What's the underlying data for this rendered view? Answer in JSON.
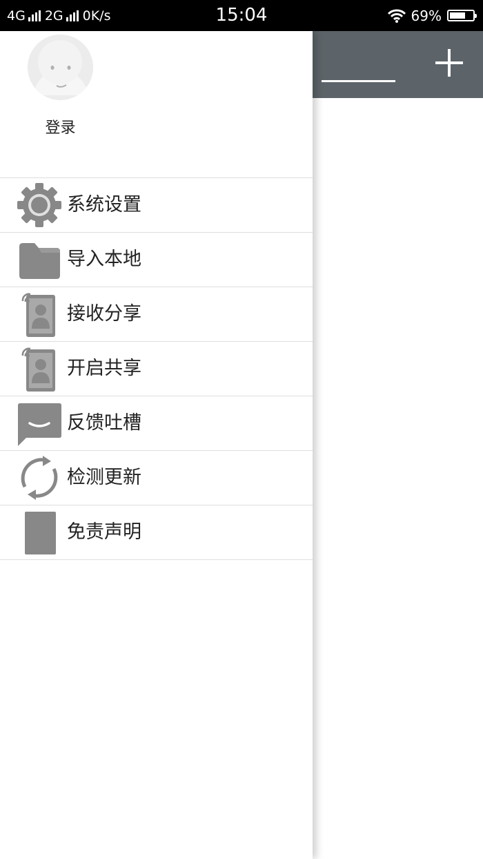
{
  "status_bar": {
    "net1": "4G",
    "net2": "2G",
    "speed": "0K/s",
    "time": "15:04",
    "battery": "69%",
    "battery_level": 0.69
  },
  "drawer": {
    "login_label": "登录",
    "menu": [
      {
        "label": "系统设置",
        "icon": "gear-icon"
      },
      {
        "label": "导入本地",
        "icon": "folder-icon"
      },
      {
        "label": "接收分享",
        "icon": "receive-share-icon"
      },
      {
        "label": "开启共享",
        "icon": "enable-share-icon"
      },
      {
        "label": "反馈吐槽",
        "icon": "feedback-icon"
      },
      {
        "label": "检测更新",
        "icon": "refresh-icon"
      },
      {
        "label": "免责声明",
        "icon": "document-icon"
      }
    ]
  },
  "colors": {
    "appbar": "#5c6469",
    "icon_gray": "#888888",
    "divider": "#dedede"
  }
}
